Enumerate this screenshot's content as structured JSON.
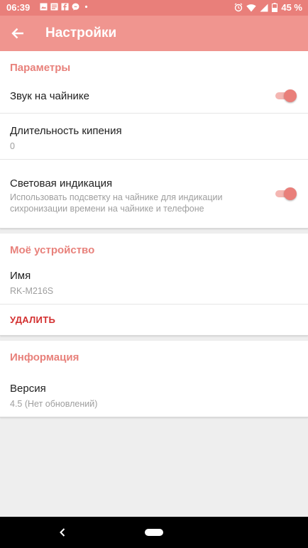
{
  "status_bar": {
    "time": "06:39",
    "battery": "45 %"
  },
  "toolbar": {
    "title": "Настройки"
  },
  "sections": {
    "params": {
      "title": "Параметры",
      "sound": {
        "label": "Звук на чайнике",
        "enabled": true
      },
      "boil": {
        "label": "Длительность кипения",
        "value": "0"
      },
      "light": {
        "label": "Световая индикация",
        "description": "Использовать подсветку на чайнике для индикации сихронизации времени на чайнике и телефоне",
        "enabled": true
      }
    },
    "device": {
      "title": "Моё устройство",
      "name_label": "Имя",
      "name_value": "RK-M216S",
      "delete_label": "УДАЛИТЬ"
    },
    "info": {
      "title": "Информация",
      "version_label": "Версия",
      "version_value": "4.5 (Нет обновлений)"
    }
  },
  "colors": {
    "accent": "#e97f7a",
    "toolbar": "#f0958f",
    "danger": "#d32f2f"
  }
}
